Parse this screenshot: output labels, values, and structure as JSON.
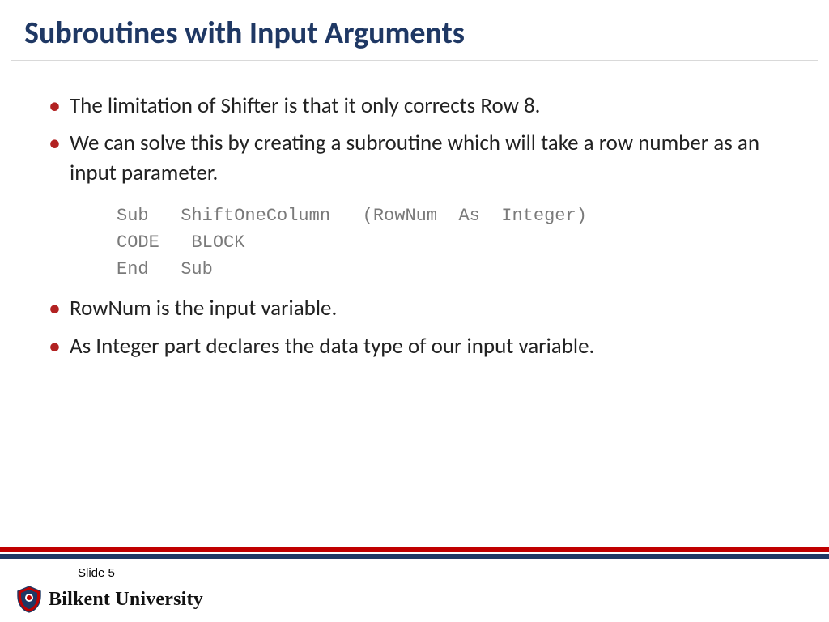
{
  "title": "Subroutines with Input Arguments",
  "bullets": [
    "The limitation of Shifter is that it only corrects Row 8.",
    "We can solve this by creating a subroutine which will take a row number as an input parameter."
  ],
  "code": "Sub   ShiftOneColumn   (RowNum  As  Integer)\nCODE   BLOCK\nEnd   Sub",
  "bullets2": [
    "RowNum is the input variable.",
    "As  Integer part declares the data type of our input variable."
  ],
  "footer": {
    "slide_label": "Slide 5",
    "university": "Bilkent University"
  },
  "colors": {
    "title": "#1f3864",
    "bullet_marker": "#b22222",
    "bar_red": "#c00000",
    "bar_navy": "#1f3864"
  }
}
